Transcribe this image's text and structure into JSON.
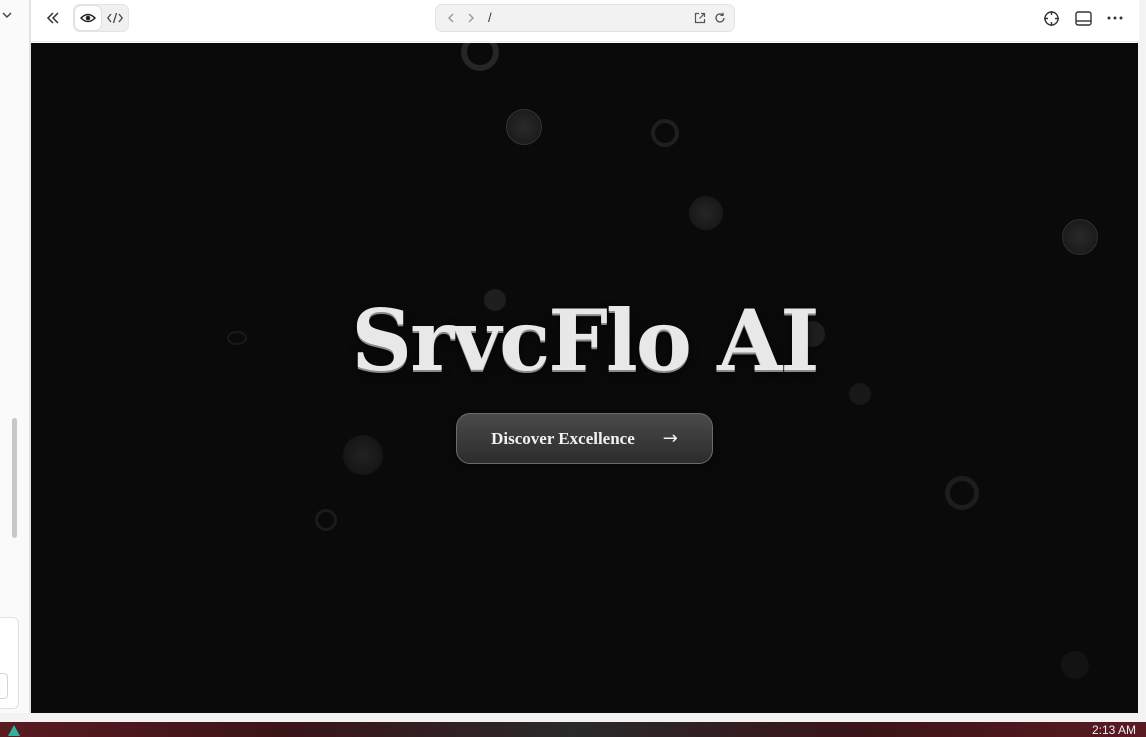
{
  "toolbar": {
    "collapse_icon": "double-chevron-left-icon",
    "preview_icon": "eye-icon",
    "code_icon": "code-icon",
    "url_path": "/",
    "right_icons": [
      "crosshair-icon",
      "panel-layout-icon",
      "more-icon"
    ]
  },
  "hero": {
    "title": "SrvcFlo AI",
    "cta_label": "Discover Excellence",
    "cta_arrow": "→"
  },
  "taskbar": {
    "clock": "2:13 AM"
  },
  "colors": {
    "hero_background": "#0a0a0a",
    "title_color": "#e8e8e8",
    "button_background": "#3a3a3a"
  }
}
